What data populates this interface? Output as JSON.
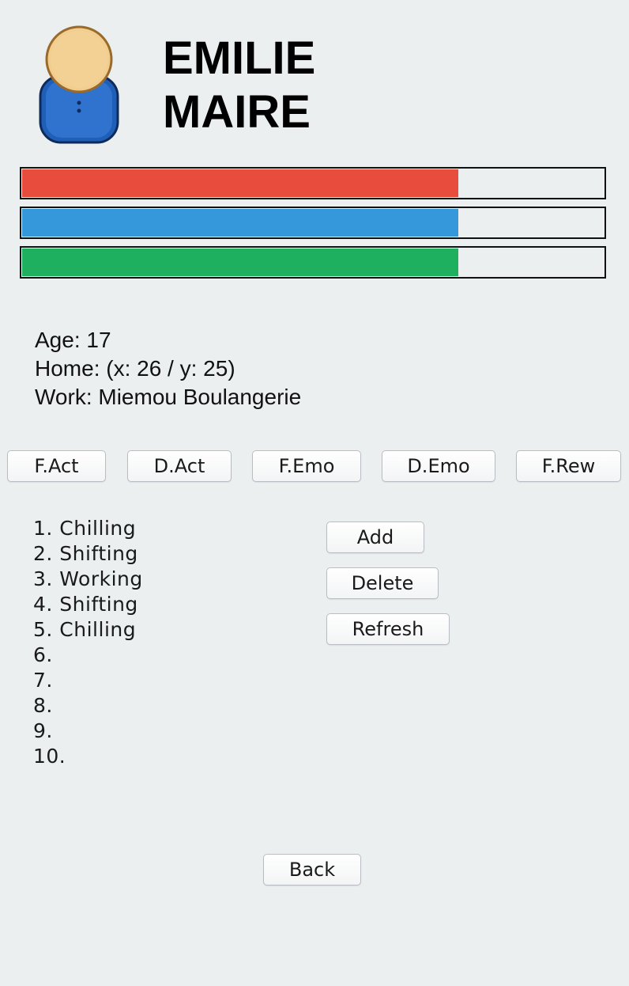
{
  "person": {
    "first_name": "EMILIE",
    "last_name": "MAIRE"
  },
  "stats": [
    {
      "color": "#e74c3c",
      "level": 0.75
    },
    {
      "color": "#3498db",
      "level": 0.75
    },
    {
      "color": "#1eaf5f",
      "level": 0.75
    }
  ],
  "info": {
    "age": "Age: 17",
    "home": "Home: (x: 26 / y: 25)",
    "work": "Work: Miemou Boulangerie"
  },
  "tabs": {
    "f_act": "F.Act",
    "d_act": "D.Act",
    "f_emo": "F.Emo",
    "d_emo": "D.Emo",
    "f_rew": "F.Rew"
  },
  "schedule": [
    "1. Chilling",
    "2. Shifting",
    "3. Working",
    "4. Shifting",
    "5. Chilling",
    "6.",
    "7.",
    "8.",
    "9.",
    "10."
  ],
  "actions": {
    "add": "Add",
    "delete": "Delete",
    "refresh": "Refresh"
  },
  "back": "Back",
  "icons": {
    "avatar": "person-icon"
  }
}
